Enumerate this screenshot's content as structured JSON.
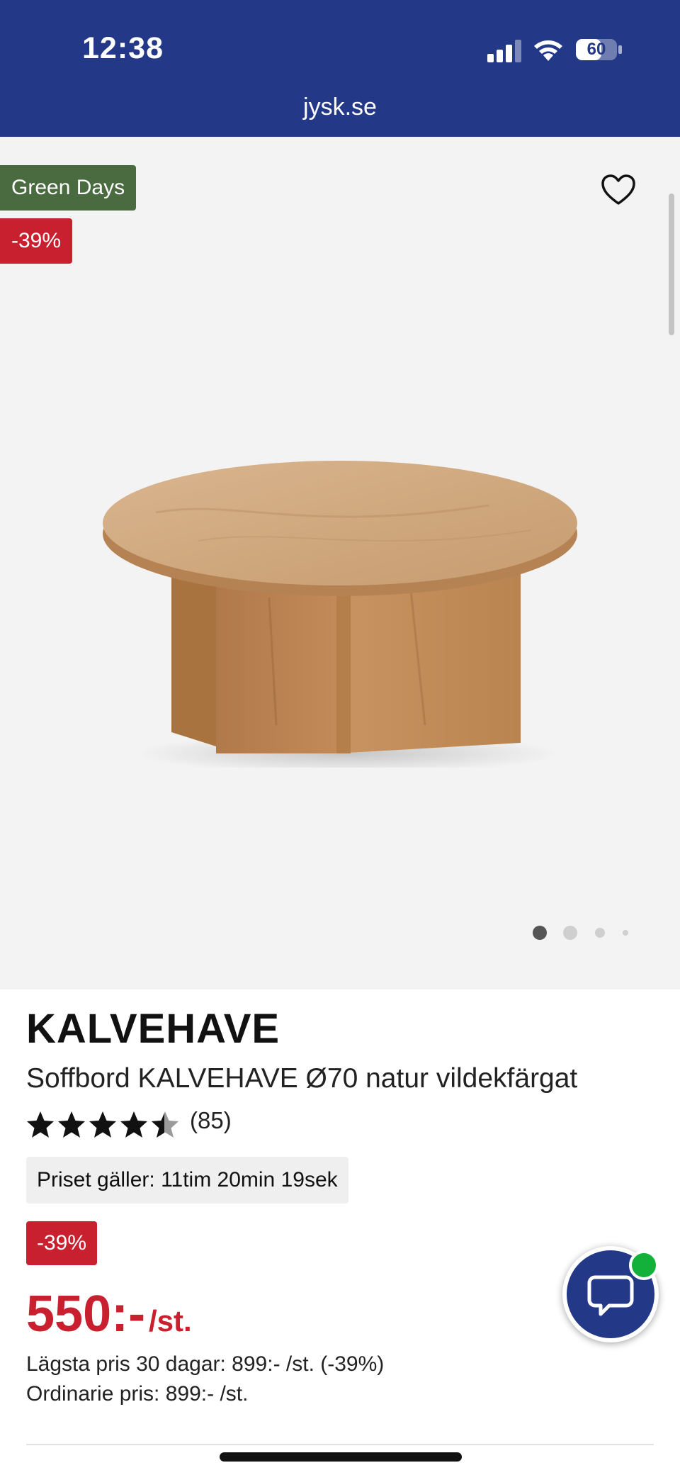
{
  "status_bar": {
    "time": "12:38",
    "battery": "60"
  },
  "browser": {
    "url": "jysk.se"
  },
  "hero": {
    "badge_campaign": "Green Days",
    "badge_discount": "-39%",
    "carousel": {
      "count": 4,
      "active_index": 0
    },
    "icons": {
      "favorite": "heart-icon"
    }
  },
  "product": {
    "brand": "KALVEHAVE",
    "title": "Soffbord KALVEHAVE Ø70 natur vildekfärgat",
    "rating": {
      "value": 4.5,
      "max": 5,
      "count_label": "(85)"
    },
    "timer_label": "Priset gäller: 11tim 20min 19sek",
    "discount_badge": "-39%",
    "price": "550:-",
    "price_unit": "/st.",
    "lowest_price_line": "Lägsta pris 30 dagar: 899:- /st. (-39%)",
    "ordinary_price_line": "Ordinarie pris: 899:- /st."
  },
  "chat": {
    "icon": "chat-bubble-icon",
    "status": "online"
  },
  "colors": {
    "brand_blue": "#233887",
    "sale_red": "#c8202f",
    "campaign_green": "#4a6b3f",
    "online_green": "#13b13a"
  }
}
